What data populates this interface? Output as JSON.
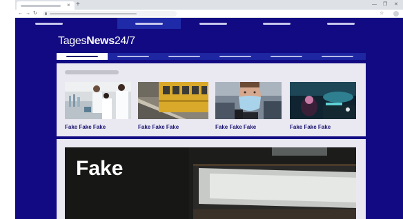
{
  "site": {
    "logo": {
      "regular": "Tages",
      "bold": "News",
      "suffix": "24/7"
    }
  },
  "news_strip": {
    "items": [
      {
        "caption": "Fake Fake Fake",
        "image": "lab-scientists-photo"
      },
      {
        "caption": "Fake Fake Fake",
        "image": "yellow-train-platform-photo"
      },
      {
        "caption": "Fake Fake Fake",
        "image": "man-with-face-mask-photo"
      },
      {
        "caption": "Fake Fake Fake",
        "image": "car-interior-night-photo"
      }
    ]
  },
  "hero": {
    "title": "Fake"
  },
  "colors": {
    "page_background": "#120a82",
    "secondary_nav": "#1e26a1",
    "card_background": "#eae9f2",
    "caption_text": "#160f6e"
  },
  "icons": {
    "tab_close": "close-icon",
    "new_tab": "plus-icon",
    "back": "back-arrow-icon",
    "forward": "forward-arrow-icon",
    "reload": "reload-icon",
    "bookmark": "star-icon",
    "menu": "kebab-menu-icon"
  }
}
